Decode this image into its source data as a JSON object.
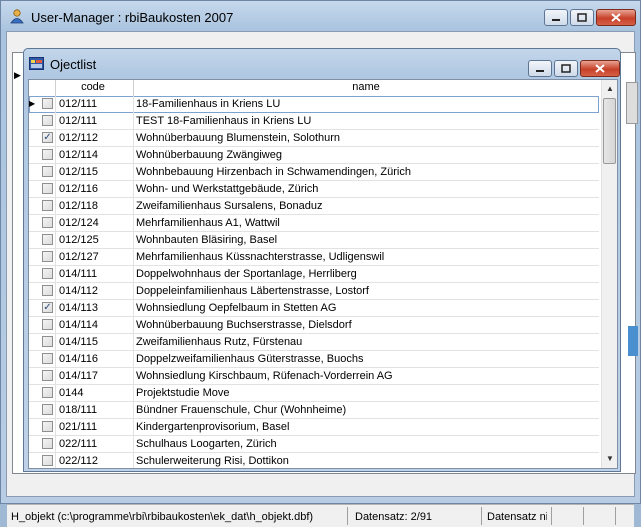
{
  "outer_window": {
    "title": "User-Manager : rbiBaukosten 2007"
  },
  "inner_window": {
    "title": "Ojectlist",
    "columns": [
      "code",
      "name"
    ],
    "rows": [
      {
        "code": "012/111",
        "name": "18-Familienhaus in Kriens LU",
        "checked": false,
        "current": true
      },
      {
        "code": "012/111",
        "name": "TEST 18-Familienhaus in Kriens LU",
        "checked": false
      },
      {
        "code": "012/112",
        "name": "Wohnüberbauung Blumenstein, Solothurn",
        "checked": true
      },
      {
        "code": "012/114",
        "name": "Wohnüberbauung Zwängiweg",
        "checked": false
      },
      {
        "code": "012/115",
        "name": "Wohnbebauung Hirzenbach in Schwamendingen, Zürich",
        "checked": false
      },
      {
        "code": "012/116",
        "name": "Wohn- und Werkstattgebäude, Zürich",
        "checked": false
      },
      {
        "code": "012/118",
        "name": "Zweifamilienhaus Sursalens, Bonaduz",
        "checked": false
      },
      {
        "code": "012/124",
        "name": "Mehrfamilienhaus A1, Wattwil",
        "checked": false
      },
      {
        "code": "012/125",
        "name": "Wohnbauten Bläsiring, Basel",
        "checked": false
      },
      {
        "code": "012/127",
        "name": "Mehrfamilienhaus Küssnachterstrasse, Udligenswil",
        "checked": false
      },
      {
        "code": "014/111",
        "name": "Doppelwohnhaus der Sportanlage, Herrliberg",
        "checked": false
      },
      {
        "code": "014/112",
        "name": "Doppeleinfamilienhaus Läbertenstrasse, Lostorf",
        "checked": false
      },
      {
        "code": "014/113",
        "name": "Wohnsiedlung Oepfelbaum in Stetten AG",
        "checked": true
      },
      {
        "code": "014/114",
        "name": "Wohnüberbauung Buchserstrasse, Dielsdorf",
        "checked": false
      },
      {
        "code": "014/115",
        "name": "Zweifamilienhaus Rutz, Fürstenau",
        "checked": false
      },
      {
        "code": "014/116",
        "name": "Doppelzweifamilienhaus Güterstrasse, Buochs",
        "checked": false
      },
      {
        "code": "014/117",
        "name": "Wohnsiedlung Kirschbaum, Rüfenach-Vorderrein AG",
        "checked": false
      },
      {
        "code": "0144",
        "name": "Projektstudie Move",
        "checked": false
      },
      {
        "code": "018/111",
        "name": "Bündner Frauenschule, Chur (Wohnheime)",
        "checked": false
      },
      {
        "code": "021/111",
        "name": "Kindergartenprovisorium, Basel",
        "checked": false
      },
      {
        "code": "022/111",
        "name": "Schulhaus Loogarten, Zürich",
        "checked": false
      },
      {
        "code": "022/112",
        "name": "Schulerweiterung Risi, Dottikon",
        "checked": false
      }
    ]
  },
  "statusbar": {
    "file": "H_objekt (c:\\programme\\rbi\\rbibaukosten\\ek_dat\\h_objekt.dbf)",
    "record": "Datensatz: 2/91",
    "record_state": "Datensatz nich"
  }
}
